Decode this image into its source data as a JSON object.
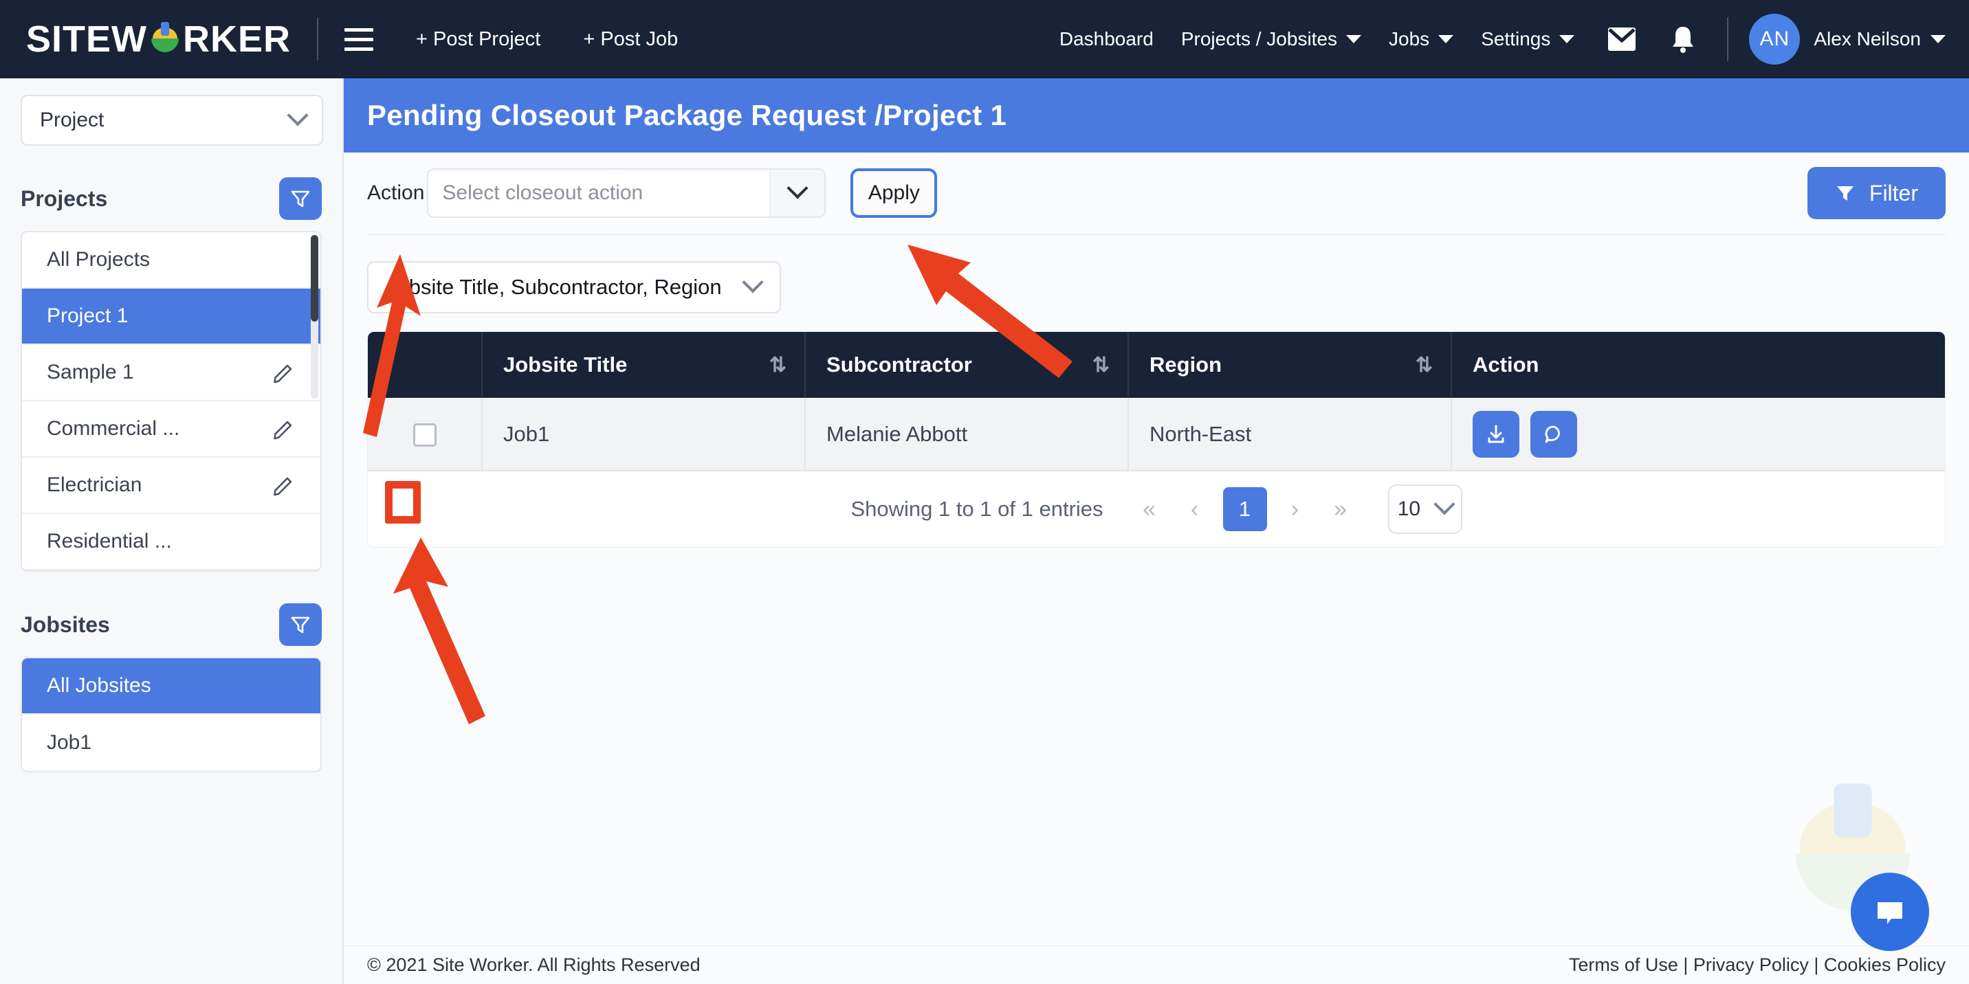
{
  "brand": {
    "name_left": "SITEW",
    "name_right": "RKER",
    "hat_icon": "hard-hat-icon",
    "accent": "#4a7ae0",
    "navy": "#182338"
  },
  "topnav": {
    "menu_icon": "hamburger-icon",
    "post_project": "+ Post Project",
    "post_job": "+ Post Job",
    "links": [
      {
        "label": "Dashboard",
        "has_caret": false
      },
      {
        "label": "Projects / Jobsites",
        "has_caret": true
      },
      {
        "label": "Jobs",
        "has_caret": true
      },
      {
        "label": "Settings",
        "has_caret": true
      }
    ],
    "mail_icon": "envelope-icon",
    "bell_icon": "bell-icon",
    "avatar_initials": "AN",
    "user_name": "Alex Neilson"
  },
  "sidebar": {
    "entity_select": {
      "value": "Project",
      "icon": "chevron-down-icon"
    },
    "projects": {
      "title": "Projects",
      "filter_icon": "filter-icon",
      "items": [
        {
          "label": "All Projects",
          "active": false,
          "edit": false
        },
        {
          "label": "Project 1",
          "active": true,
          "edit": false
        },
        {
          "label": "Sample 1",
          "active": false,
          "edit": true
        },
        {
          "label": "Commercial ...",
          "active": false,
          "edit": true
        },
        {
          "label": "Electrician",
          "active": false,
          "edit": true
        },
        {
          "label": "Residential ...",
          "active": false,
          "edit": false
        }
      ]
    },
    "jobsites": {
      "title": "Jobsites",
      "filter_icon": "filter-icon",
      "items": [
        {
          "label": "All Jobsites",
          "active": true
        },
        {
          "label": "Job1",
          "active": false
        }
      ]
    }
  },
  "page": {
    "title": "Pending Closeout Package Request /Project 1"
  },
  "toolbar": {
    "action_label": "Action",
    "action_placeholder": "Select closeout action",
    "action_value": "",
    "apply_label": "Apply",
    "filter_label": "Filter",
    "filter_icon": "filter-icon",
    "columns_select_value": "Jobsite Title, Subcontractor, Region"
  },
  "table": {
    "columns": [
      {
        "label": "",
        "sortable": false
      },
      {
        "label": "Jobsite Title",
        "sortable": true
      },
      {
        "label": "Subcontractor",
        "sortable": true
      },
      {
        "label": "Region",
        "sortable": true
      },
      {
        "label": "Action",
        "sortable": false
      }
    ],
    "sort_icon": "sort-updown-icon",
    "rows": [
      {
        "selected": false,
        "jobsite_title": "Job1",
        "subcontractor": "Melanie Abbott",
        "region": "North-East",
        "actions": [
          "download-icon",
          "chat-icon"
        ]
      }
    ]
  },
  "pagination": {
    "info": "Showing 1 to 1 of 1 entries",
    "first": "«",
    "prev": "‹",
    "pages": [
      "1"
    ],
    "current_page": "1",
    "next": "›",
    "last": "»",
    "page_size": "10"
  },
  "chat": {
    "fab_icon": "chat-bubble-icon",
    "watermark_icon": "hard-hat-watermark"
  },
  "footer": {
    "copyright": "© 2021 Site Worker. All Rights Reserved",
    "links": "Terms of Use | Privacy Policy | Cookies Policy"
  },
  "annotations": {
    "arrow_color": "#e8401f",
    "items": [
      {
        "name": "arrow-to-action-label"
      },
      {
        "name": "arrow-to-apply-button"
      },
      {
        "name": "arrow-to-row-checkbox"
      },
      {
        "name": "highlight-row-checkbox"
      }
    ]
  }
}
